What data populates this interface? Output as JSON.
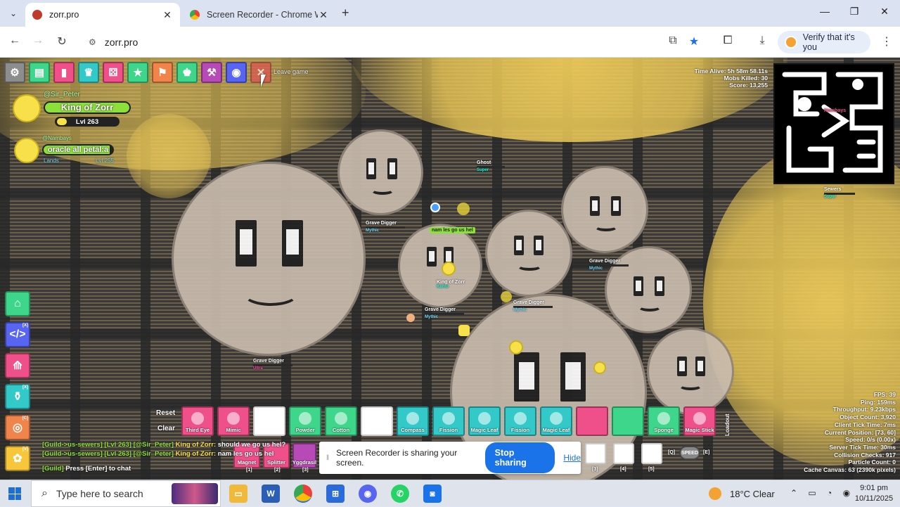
{
  "browser": {
    "tabs": [
      {
        "title": "zorr.pro",
        "active": true
      },
      {
        "title": "Screen Recorder - Chrome Web",
        "active": false
      }
    ],
    "url": "zorr.pro",
    "verify_label": "Verify that it's you"
  },
  "game": {
    "leave_tooltip": "Leave game",
    "players": [
      {
        "username": "@Sir_Peter",
        "title": "King of Zorr",
        "level": "Lvl 263"
      },
      {
        "username": "@Nambays",
        "title": "oracle all petal:a",
        "guild": "Lands",
        "level": "Lvl 255"
      }
    ],
    "stats": {
      "time_alive": "Time Alive: 5h 58m 58.11s",
      "mobs_killed": "Mobs Killed: 30",
      "score": "Score: 13,255"
    },
    "minimap_labels": [
      "Nambays"
    ],
    "mob_labels": [
      {
        "name": "Grave Digger",
        "rarity": "Mythic"
      },
      {
        "name": "Grave Digger",
        "rarity": "Mythic"
      },
      {
        "name": "Grave Digger",
        "rarity": "Mythic"
      },
      {
        "name": "Grave Digger",
        "rarity": "Mythic"
      },
      {
        "name": "Grave Digger",
        "rarity": "Ultra"
      },
      {
        "name": "Sewers",
        "rarity": "Super"
      },
      {
        "name": "Ghost",
        "rarity": "Super"
      }
    ],
    "center_player": {
      "title": "King of Zorr",
      "guild": "Kanto"
    },
    "speech_bubble": "nam les go us hel",
    "loadout": {
      "reset": "Reset",
      "clear": "Clear",
      "label": "Loadout",
      "slots": [
        {
          "name": "Third Eye",
          "color": "#f0508a"
        },
        {
          "name": "Mimic",
          "color": "#f0508a"
        },
        {
          "name": "",
          "color": "#ffffff"
        },
        {
          "name": "Powder",
          "color": "#3dd68a"
        },
        {
          "name": "Cotton",
          "color": "#3dd68a"
        },
        {
          "name": "",
          "color": "#ffffff"
        },
        {
          "name": "Compass",
          "color": "#33c9c9"
        },
        {
          "name": "Fission",
          "color": "#33c9c9"
        },
        {
          "name": "Magic Leaf",
          "color": "#33c9c9"
        },
        {
          "name": "Fission",
          "color": "#33c9c9"
        },
        {
          "name": "Magic Leaf",
          "color": "#33c9c9"
        },
        {
          "name": "",
          "color": "#f0508a"
        },
        {
          "name": "",
          "color": "#3dd68a"
        },
        {
          "name": "Sponge",
          "color": "#3dd68a"
        },
        {
          "name": "Magic Stick",
          "color": "#f0508a"
        }
      ],
      "secondary": [
        {
          "name": "Magnet",
          "key": "[1]"
        },
        {
          "name": "Splitter",
          "key": "[2]"
        },
        {
          "name": "Yggdrasil",
          "key": "[3]"
        },
        {
          "name": "",
          "key": "[3]"
        },
        {
          "name": "",
          "key": "[4]"
        },
        {
          "name": "",
          "key": "[5]"
        }
      ],
      "speed_label": "SPEED",
      "speed_keys": [
        "[Q]",
        "[E]"
      ]
    },
    "chat": [
      {
        "prefix": "[Guild->us-sewers] [Lvl 263] [@Sir_Peter]",
        "name": "King of Zorr:",
        "msg": "should we go us hel?"
      },
      {
        "prefix": "[Guild->us-sewers] [Lvl 263] [@Sir_Peter]",
        "name": "King of Zorr:",
        "msg": "nam les go us hel"
      }
    ],
    "chat_prompt_tag": "[Guild]",
    "chat_prompt": "Press [Enter] to chat",
    "perf": [
      "FPS: 39",
      "Ping: 159ms",
      "Throughput: 9.23kbps",
      "Object Count: 3,920",
      "Client Tick Time: 7ms",
      "Current Position: [73, 60]",
      "Speed: 0/s (0.00x)",
      "Server Tick Time: 30ms",
      "Collision Checks: 917",
      "Particle Count: 0",
      "Cache Canvas: 63 (2390k pixels)"
    ]
  },
  "share_bar": {
    "message": "Screen Recorder is sharing your screen.",
    "stop": "Stop sharing",
    "hide": "Hide"
  },
  "taskbar": {
    "search_placeholder": "Type here to search",
    "weather": "18°C  Clear",
    "time": "9:01 pm",
    "date": "10/11/2025"
  }
}
